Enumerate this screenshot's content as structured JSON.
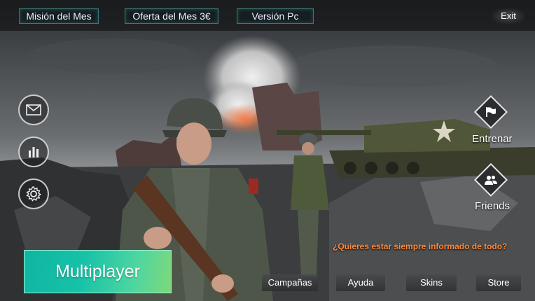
{
  "top_menu": {
    "mision": "Misión del Mes",
    "oferta": "Oferta del Mes 3€",
    "version": "Versión Pc",
    "exit": "Exit"
  },
  "side_menu": {
    "entrenar": "Entrenar",
    "friends": "Friends"
  },
  "icons": {
    "mail": "mail-icon",
    "stats": "bar-chart-icon",
    "settings": "gear-icon",
    "entrenar": "flag-icon",
    "friends": "friends-icon"
  },
  "info_text": "¿Quieres estar siempre informado de todo?",
  "multiplayer_label": "Multiplayer",
  "bottom_menu": {
    "campanas": "Campañas",
    "ayuda": "Ayuda",
    "skins": "Skins",
    "store": "Store"
  },
  "colors": {
    "accent_info": "#ff8a3a",
    "multiplayer_start": "#10b5a2",
    "multiplayer_end": "#7ed87a",
    "top_button_border": "#3b7a78"
  }
}
